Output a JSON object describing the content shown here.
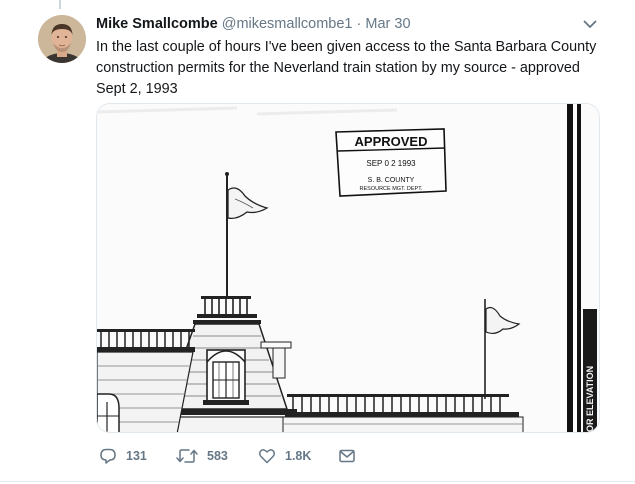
{
  "tweet": {
    "author_name": "Mike Smallcombe",
    "handle": "@mikesmallcombe1",
    "separator": "·",
    "timestamp": "Mar 30",
    "text": "In the last couple of hours I've been given access to the Santa Barbara County construction permits for the Neverland train station by my source - approved Sept 2, 1993"
  },
  "media": {
    "stamp_status": "APPROVED",
    "stamp_date": "SEP 0 2 1993",
    "stamp_line1": "S. B. COUNTY",
    "stamp_line2": "RESOURCE MGT. DEPT.",
    "side_label": "OR ELEVATION"
  },
  "actions": {
    "reply_count": "131",
    "retweet_count": "583",
    "like_count": "1.8K",
    "reply_icon": "reply-icon",
    "retweet_icon": "retweet-icon",
    "like_icon": "heart-icon",
    "message_icon": "envelope-icon"
  },
  "colors": {
    "text_primary": "#14171a",
    "text_secondary": "#657786",
    "border": "#e1e8ed"
  }
}
